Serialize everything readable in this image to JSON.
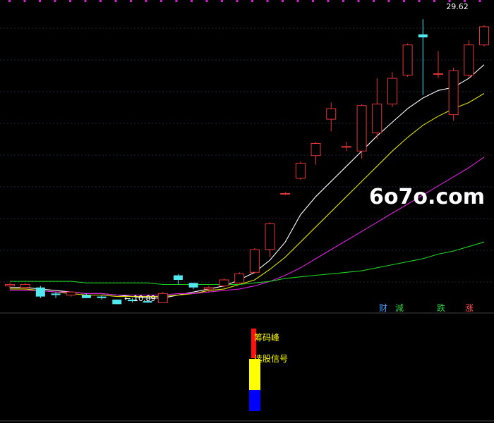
{
  "watermark": "6o7o.com",
  "price_labels": {
    "high": "29.62",
    "low": "10.89",
    "low_prefix": "←"
  },
  "tags": [
    {
      "label": "财",
      "color": "#3fa0ff"
    },
    {
      "label": "減",
      "color": "#2ecc40"
    },
    {
      "label": "跌",
      "color": "#2ecc40"
    },
    {
      "label": "涨",
      "color": "#ff4d4d"
    }
  ],
  "indicator": {
    "labels": [
      "筹码峰",
      "选股信号"
    ],
    "label_color": "#ffff00",
    "bars": [
      {
        "name": "red",
        "color": "#ff1010"
      },
      {
        "name": "yellow",
        "color": "#ffff00"
      },
      {
        "name": "blue",
        "color": "#0000ff"
      }
    ]
  },
  "colors": {
    "up": "#e63434",
    "down": "#52e8f0",
    "ma_white": "#ffffff",
    "ma_yellow": "#e0e000",
    "ma_magenta": "#e020e0",
    "ma_green": "#20d020",
    "grid": "#1e2a36",
    "separator": "#404040"
  },
  "chart_data": {
    "type": "candlestick",
    "x": [
      1,
      2,
      3,
      4,
      5,
      6,
      7,
      8,
      9,
      10,
      11,
      12,
      13,
      14,
      15,
      16,
      17,
      18,
      19,
      20,
      21,
      22,
      23,
      24,
      25,
      26,
      27,
      28,
      29,
      30,
      31,
      32,
      33,
      34
    ],
    "candles": [
      {
        "o": 12.1,
        "h": 12.3,
        "l": 11.9,
        "c": 12.2
      },
      {
        "o": 12.0,
        "h": 12.3,
        "l": 11.8,
        "c": 12.2
      },
      {
        "o": 12.0,
        "h": 12.1,
        "l": 11.3,
        "c": 11.4
      },
      {
        "o": 11.6,
        "h": 11.7,
        "l": 11.3,
        "c": 11.5
      },
      {
        "o": 11.5,
        "h": 11.7,
        "l": 11.4,
        "c": 11.7
      },
      {
        "o": 11.5,
        "h": 11.6,
        "l": 11.3,
        "c": 11.3
      },
      {
        "o": 11.4,
        "h": 11.5,
        "l": 11.2,
        "c": 11.3
      },
      {
        "o": 11.2,
        "h": 11.2,
        "l": 10.89,
        "c": 10.9
      },
      {
        "o": 11.2,
        "h": 11.3,
        "l": 11.0,
        "c": 11.1
      },
      {
        "o": 11.1,
        "h": 11.2,
        "l": 11.0,
        "c": 11.0
      },
      {
        "o": 11.0,
        "h": 11.7,
        "l": 11.0,
        "c": 11.6
      },
      {
        "o": 12.8,
        "h": 12.9,
        "l": 12.2,
        "c": 12.5
      },
      {
        "o": 12.3,
        "h": 12.3,
        "l": 11.9,
        "c": 12.0
      },
      {
        "o": 11.9,
        "h": 12.1,
        "l": 11.7,
        "c": 12.0
      },
      {
        "o": 12.1,
        "h": 12.6,
        "l": 12.0,
        "c": 12.5
      },
      {
        "o": 12.3,
        "h": 13.0,
        "l": 12.2,
        "c": 12.9
      },
      {
        "o": 13.0,
        "h": 14.6,
        "l": 12.9,
        "c": 14.5
      },
      {
        "o": 14.5,
        "h": 16.3,
        "l": 14.0,
        "c": 16.2
      },
      {
        "o": 18.2,
        "h": 18.3,
        "l": 18.1,
        "c": 18.2
      },
      {
        "o": 19.2,
        "h": 20.3,
        "l": 19.1,
        "c": 20.2
      },
      {
        "o": 20.7,
        "h": 21.6,
        "l": 20.1,
        "c": 21.5
      },
      {
        "o": 23.1,
        "h": 24.2,
        "l": 22.3,
        "c": 23.8
      },
      {
        "o": 21.3,
        "h": 21.6,
        "l": 21.0,
        "c": 21.3
      },
      {
        "o": 21.0,
        "h": 24.1,
        "l": 20.5,
        "c": 24.0
      },
      {
        "o": 22.2,
        "h": 25.8,
        "l": 21.8,
        "c": 24.1
      },
      {
        "o": 24.1,
        "h": 26.2,
        "l": 23.9,
        "c": 25.8
      },
      {
        "o": 26.0,
        "h": 28.1,
        "l": 25.9,
        "c": 28.0
      },
      {
        "o": 28.7,
        "h": 29.7,
        "l": 24.7,
        "c": 28.5
      },
      {
        "o": 26.1,
        "h": 27.6,
        "l": 25.8,
        "c": 26.1
      },
      {
        "o": 23.4,
        "h": 26.5,
        "l": 23.0,
        "c": 26.3
      },
      {
        "o": 26.0,
        "h": 28.3,
        "l": 25.8,
        "c": 28.0
      },
      {
        "o": 28.0,
        "h": 29.3,
        "l": 27.9,
        "c": 29.2
      }
    ],
    "moving_averages": [
      {
        "color": "#ffffff",
        "values": [
          12.0,
          12.0,
          11.9,
          11.8,
          11.7,
          11.6,
          11.6,
          11.5,
          11.4,
          11.3,
          11.3,
          11.5,
          11.7,
          11.9,
          12.1,
          12.5,
          13.0,
          13.8,
          15.0,
          16.8,
          18.0,
          19.0,
          20.0,
          21.0,
          22.0,
          22.9,
          23.8,
          24.5,
          25.0,
          25.2,
          25.8,
          26.7
        ]
      },
      {
        "color": "#e0e000",
        "values": [
          11.9,
          11.9,
          11.8,
          11.7,
          11.6,
          11.5,
          11.5,
          11.4,
          11.4,
          11.4,
          11.4,
          11.5,
          11.6,
          11.8,
          11.9,
          12.2,
          12.5,
          13.2,
          14.0,
          15.0,
          16.0,
          17.0,
          18.0,
          19.0,
          20.0,
          21.0,
          21.9,
          22.7,
          23.3,
          23.8,
          24.2,
          24.8
        ]
      },
      {
        "color": "#e020e0",
        "values": [
          11.8,
          11.8,
          11.8,
          11.7,
          11.7,
          11.6,
          11.6,
          11.5,
          11.5,
          11.5,
          11.5,
          11.6,
          11.6,
          11.7,
          11.8,
          11.9,
          12.1,
          12.4,
          12.8,
          13.3,
          13.9,
          14.5,
          15.1,
          15.7,
          16.3,
          16.9,
          17.5,
          18.1,
          18.7,
          19.3,
          19.9,
          20.6
        ]
      },
      {
        "color": "#20d020",
        "values": [
          12.4,
          12.4,
          12.4,
          12.4,
          12.4,
          12.3,
          12.3,
          12.3,
          12.3,
          12.3,
          12.2,
          12.2,
          12.2,
          12.2,
          12.2,
          12.2,
          12.3,
          12.4,
          12.6,
          12.7,
          12.8,
          12.9,
          13.0,
          13.1,
          13.3,
          13.5,
          13.7,
          13.9,
          14.2,
          14.4,
          14.7,
          15.0
        ]
      }
    ],
    "ylim": [
      10.5,
      30.5
    ]
  }
}
